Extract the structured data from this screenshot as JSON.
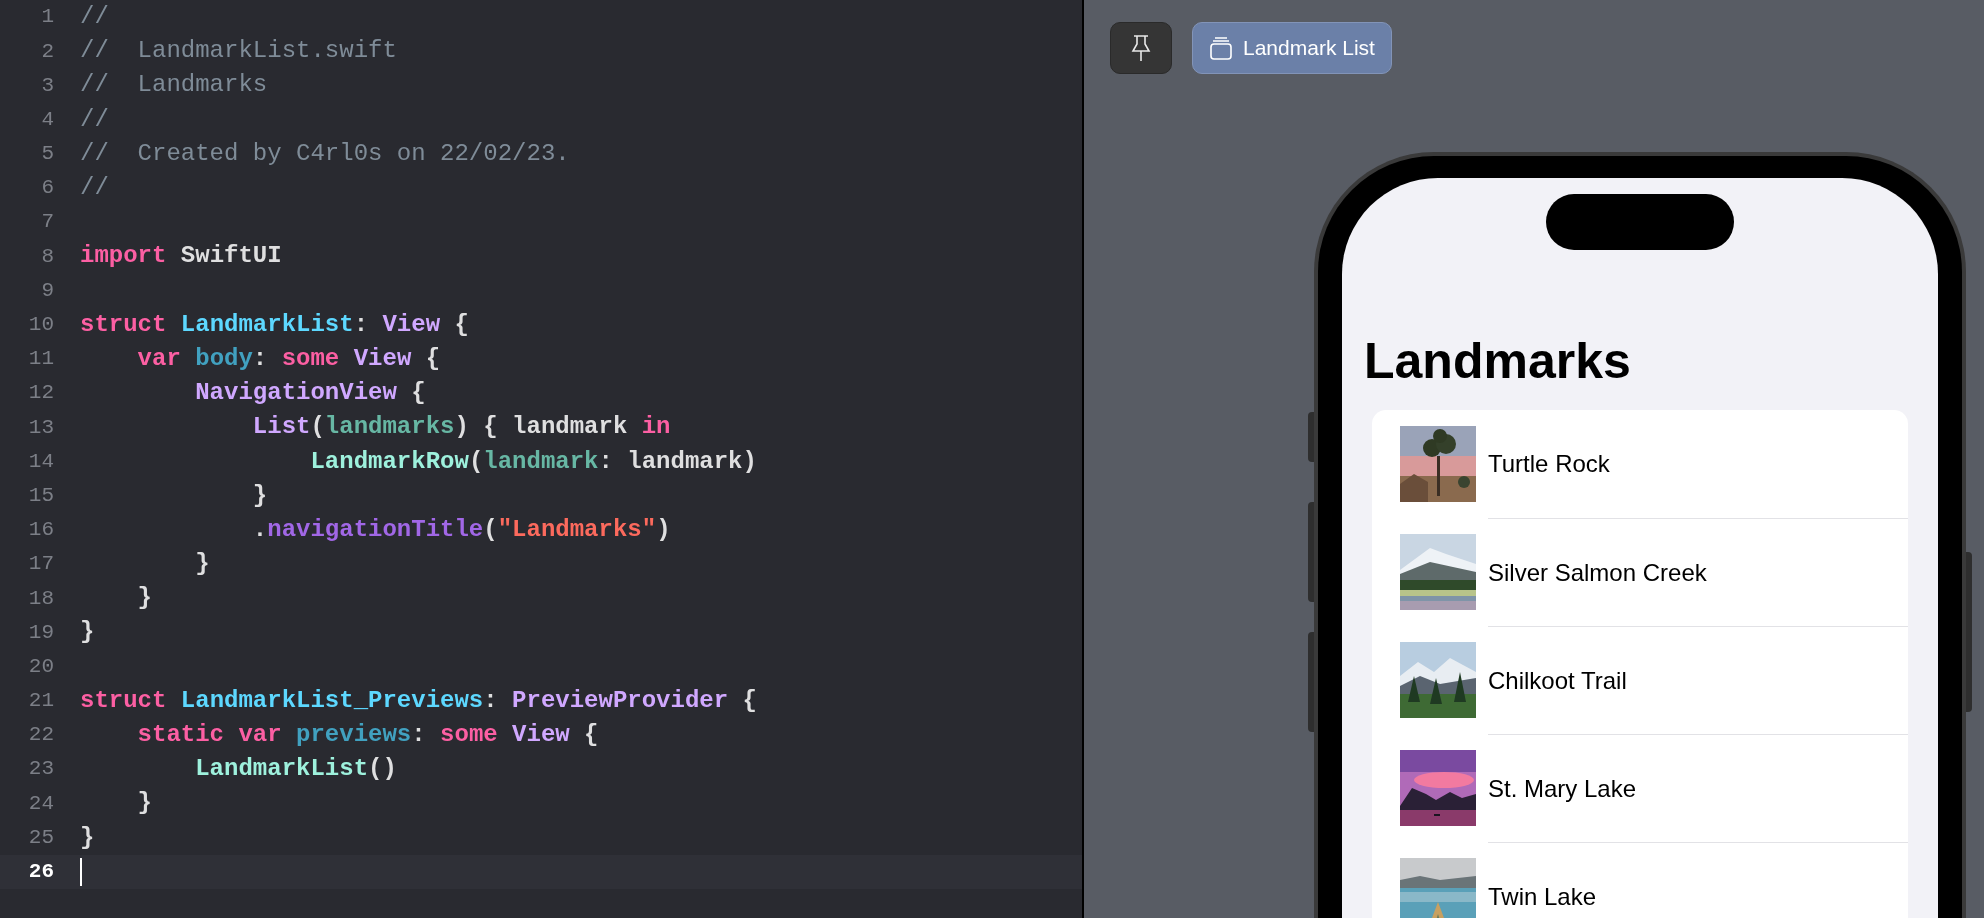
{
  "editor": {
    "lines": [
      {
        "number": "1",
        "current": false,
        "tokens": [
          {
            "text": "//",
            "kind": "comment"
          }
        ]
      },
      {
        "number": "2",
        "current": false,
        "tokens": [
          {
            "text": "//  LandmarkList.swift",
            "kind": "comment"
          }
        ]
      },
      {
        "number": "3",
        "current": false,
        "tokens": [
          {
            "text": "//  Landmarks",
            "kind": "comment"
          }
        ]
      },
      {
        "number": "4",
        "current": false,
        "tokens": [
          {
            "text": "//",
            "kind": "comment"
          }
        ]
      },
      {
        "number": "5",
        "current": false,
        "tokens": [
          {
            "text": "//  Created by C4rl0s on 22/02/23.",
            "kind": "comment"
          }
        ]
      },
      {
        "number": "6",
        "current": false,
        "tokens": [
          {
            "text": "//",
            "kind": "comment"
          }
        ]
      },
      {
        "number": "7",
        "current": false
      },
      {
        "number": "8",
        "current": false,
        "tokens": [
          {
            "text": "import",
            "kind": "keyword"
          },
          {
            "text": " SwiftUI",
            "kind": "plain"
          }
        ]
      },
      {
        "number": "9",
        "current": false
      },
      {
        "number": "10",
        "current": false,
        "tokens": [
          {
            "text": "struct",
            "kind": "keyword"
          },
          {
            "text": " LandmarkList",
            "kind": "decl_type"
          },
          {
            "text": ":",
            "kind": "plain"
          },
          {
            "text": " View",
            "kind": "system_type"
          },
          {
            "text": " {",
            "kind": "plain"
          }
        ]
      },
      {
        "number": "11",
        "current": false,
        "tokens": [
          {
            "text": "    var",
            "kind": "keyword"
          },
          {
            "text": " body",
            "kind": "decl_var"
          },
          {
            "text": ":",
            "kind": "plain"
          },
          {
            "text": " some",
            "kind": "keyword"
          },
          {
            "text": " View",
            "kind": "system_type"
          },
          {
            "text": " {",
            "kind": "plain"
          }
        ]
      },
      {
        "number": "12",
        "current": false,
        "tokens": [
          {
            "text": "        NavigationView",
            "kind": "system_type"
          },
          {
            "text": " {",
            "kind": "plain"
          }
        ]
      },
      {
        "number": "13",
        "current": false,
        "tokens": [
          {
            "text": "            List",
            "kind": "system_type"
          },
          {
            "text": "(",
            "kind": "plain"
          },
          {
            "text": "landmarks",
            "kind": "project_var"
          },
          {
            "text": ") { landmark ",
            "kind": "plain"
          },
          {
            "text": "in",
            "kind": "keyword"
          }
        ]
      },
      {
        "number": "14",
        "current": false,
        "tokens": [
          {
            "text": "                LandmarkRow",
            "kind": "project_type"
          },
          {
            "text": "(",
            "kind": "plain"
          },
          {
            "text": "landmark",
            "kind": "project_var"
          },
          {
            "text": ": landmark)",
            "kind": "plain"
          }
        ]
      },
      {
        "number": "15",
        "current": false,
        "tokens": [
          {
            "text": "            }",
            "kind": "plain"
          }
        ]
      },
      {
        "number": "16",
        "current": false,
        "tokens": [
          {
            "text": "            .",
            "kind": "plain"
          },
          {
            "text": "navigationTitle",
            "kind": "method"
          },
          {
            "text": "(",
            "kind": "plain"
          },
          {
            "text": "\"Landmarks\"",
            "kind": "string"
          },
          {
            "text": ")",
            "kind": "plain"
          }
        ]
      },
      {
        "number": "17",
        "current": false,
        "tokens": [
          {
            "text": "        }",
            "kind": "plain"
          }
        ]
      },
      {
        "number": "18",
        "current": false,
        "tokens": [
          {
            "text": "    }",
            "kind": "plain"
          }
        ]
      },
      {
        "number": "19",
        "current": false,
        "tokens": [
          {
            "text": "}",
            "kind": "plain"
          }
        ]
      },
      {
        "number": "20",
        "current": false
      },
      {
        "number": "21",
        "current": false,
        "tokens": [
          {
            "text": "struct",
            "kind": "keyword"
          },
          {
            "text": " LandmarkList_Previews",
            "kind": "decl_type"
          },
          {
            "text": ":",
            "kind": "plain"
          },
          {
            "text": " PreviewProvider",
            "kind": "system_type"
          },
          {
            "text": " {",
            "kind": "plain"
          }
        ]
      },
      {
        "number": "22",
        "current": false,
        "tokens": [
          {
            "text": "    static var",
            "kind": "keyword"
          },
          {
            "text": " previews",
            "kind": "decl_var"
          },
          {
            "text": ":",
            "kind": "plain"
          },
          {
            "text": " some",
            "kind": "keyword"
          },
          {
            "text": " View",
            "kind": "system_type"
          },
          {
            "text": " {",
            "kind": "plain"
          }
        ]
      },
      {
        "number": "23",
        "current": false,
        "tokens": [
          {
            "text": "        LandmarkList",
            "kind": "project_type"
          },
          {
            "text": "()",
            "kind": "plain"
          }
        ]
      },
      {
        "number": "24",
        "current": false,
        "tokens": [
          {
            "text": "    }",
            "kind": "plain"
          }
        ]
      },
      {
        "number": "25",
        "current": false,
        "tokens": [
          {
            "text": "}",
            "kind": "plain"
          }
        ]
      },
      {
        "number": "26",
        "current": true
      }
    ]
  },
  "preview": {
    "toolbar": {
      "pin_selected": false,
      "preview_button": {
        "label": "Landmark List",
        "selected": true
      }
    },
    "phone": {
      "title": "Landmarks",
      "rows": [
        {
          "name": "Turtle Rock",
          "kind": "picture"
        },
        {
          "name": "Silver Salmon Creek",
          "kind": "picture"
        },
        {
          "name": "Chilkoot Trail",
          "kind": "picture"
        },
        {
          "name": "St. Mary Lake",
          "kind": "picture"
        },
        {
          "name": "Twin Lake",
          "kind": "picture"
        }
      ]
    }
  }
}
